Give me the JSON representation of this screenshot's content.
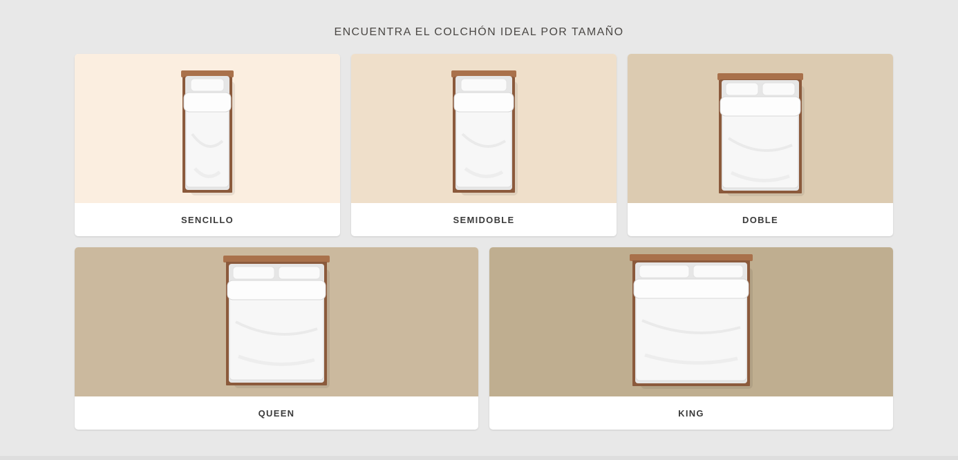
{
  "section": {
    "title": "ENCUENTRA EL COLCHÓN IDEAL POR TAMAÑO"
  },
  "colors": {
    "page_background": "#e8e8e8",
    "wood": "#8b5a3c",
    "wood_light": "#a9714b",
    "linen": "#f7f7f7"
  },
  "cards": [
    {
      "label": "SENCILLO",
      "background": "#fbeee0",
      "bed_icon": "single-bed-icon",
      "size": "single"
    },
    {
      "label": "SEMIDOBLE",
      "background": "#efdfca",
      "bed_icon": "semi-double-bed-icon",
      "size": "semidouble"
    },
    {
      "label": "DOBLE",
      "background": "#dccbb1",
      "bed_icon": "double-bed-icon",
      "size": "double"
    },
    {
      "label": "QUEEN",
      "background": "#cbb99e",
      "bed_icon": "queen-bed-icon",
      "size": "queen"
    },
    {
      "label": "KING",
      "background": "#bfae90",
      "bed_icon": "king-bed-icon",
      "size": "king"
    }
  ]
}
